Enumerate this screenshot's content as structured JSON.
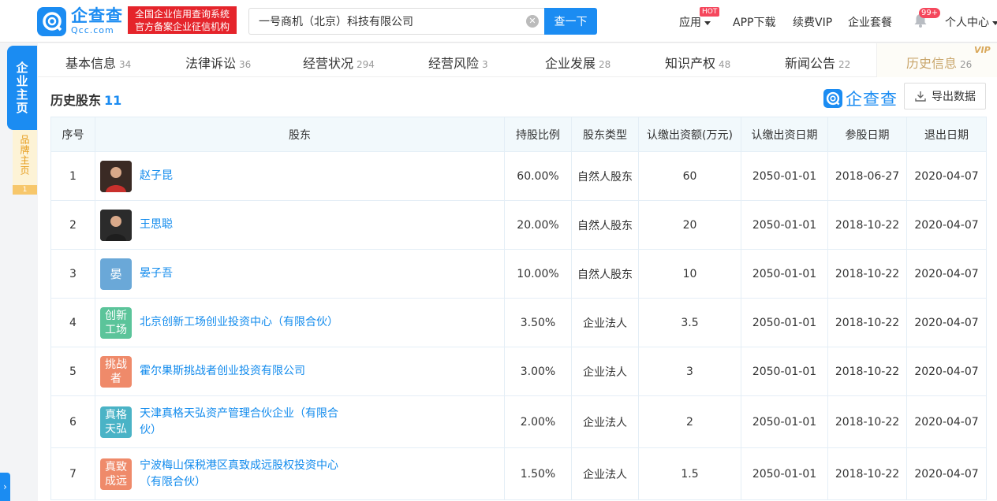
{
  "header": {
    "logo_cn": "企查查",
    "logo_en": "Qcc.com",
    "badge_line1": "全国企业信用查询系统",
    "badge_line2": "官方备案企业征信机构",
    "search_value": "一号商机（北京）科技有限公司",
    "search_button": "查一下",
    "nav": {
      "apps": "应用",
      "hot": "HOT",
      "app_download": "APP下载",
      "vip": "续费VIP",
      "package": "企业套餐",
      "msg_count": "99+",
      "user_center": "个人中心"
    }
  },
  "side": {
    "main": "企业主页",
    "brand": "品牌主页",
    "brand_count": "1"
  },
  "tabs": [
    {
      "label": "基本信息",
      "count": "34"
    },
    {
      "label": "法律诉讼",
      "count": "36"
    },
    {
      "label": "经营状况",
      "count": "294"
    },
    {
      "label": "经营风险",
      "count": "3"
    },
    {
      "label": "企业发展",
      "count": "28"
    },
    {
      "label": "知识产权",
      "count": "48"
    },
    {
      "label": "新闻公告",
      "count": "22"
    }
  ],
  "tab_active": {
    "label": "历史信息",
    "count": "26",
    "vip": "VIP"
  },
  "section": {
    "title": "历史股东",
    "count": "11",
    "brand_mark": "企查查",
    "export": "导出数据"
  },
  "table": {
    "headers": [
      "序号",
      "股东",
      "持股比例",
      "股东类型",
      "认缴出资额(万元)",
      "认缴出资日期",
      "参股日期",
      "退出日期"
    ],
    "rows": [
      {
        "no": "1",
        "name": "赵子昆",
        "avatar": "",
        "avatar_color": "#3a2a24",
        "ratio": "60.00%",
        "type": "自然人股东",
        "amount": "60",
        "sub_date": "2050-01-01",
        "join_date": "2018-06-27",
        "exit_date": "2020-04-07"
      },
      {
        "no": "2",
        "name": "王思聪",
        "avatar": "",
        "avatar_color": "#2b2b2b",
        "ratio": "20.00%",
        "type": "自然人股东",
        "amount": "20",
        "sub_date": "2050-01-01",
        "join_date": "2018-10-22",
        "exit_date": "2020-04-07"
      },
      {
        "no": "3",
        "name": "晏子吾",
        "avatar": "晏",
        "avatar_color": "#6aa8d8",
        "ratio": "10.00%",
        "type": "自然人股东",
        "amount": "10",
        "sub_date": "2050-01-01",
        "join_date": "2018-10-22",
        "exit_date": "2020-04-07"
      },
      {
        "no": "4",
        "name": "北京创新工场创业投资中心（有限合伙）",
        "avatar": "创新工场",
        "avatar_color": "#5bc49a",
        "ratio": "3.50%",
        "type": "企业法人",
        "amount": "3.5",
        "sub_date": "2050-01-01",
        "join_date": "2018-10-22",
        "exit_date": "2020-04-07"
      },
      {
        "no": "5",
        "name": "霍尔果斯挑战者创业投资有限公司",
        "avatar": "挑战者",
        "avatar_color": "#ef8a6a",
        "ratio": "3.00%",
        "type": "企业法人",
        "amount": "3",
        "sub_date": "2050-01-01",
        "join_date": "2018-10-22",
        "exit_date": "2020-04-07"
      },
      {
        "no": "6",
        "name": "天津真格天弘资产管理合伙企业（有限合伙）",
        "avatar": "真格天弘",
        "avatar_color": "#4ab3c6",
        "ratio": "2.00%",
        "type": "企业法人",
        "amount": "2",
        "sub_date": "2050-01-01",
        "join_date": "2018-10-22",
        "exit_date": "2020-04-07"
      },
      {
        "no": "7",
        "name": "宁波梅山保税港区真致成远股权投资中心（有限合伙）",
        "avatar": "真致成远",
        "avatar_color": "#ef8a6a",
        "ratio": "1.50%",
        "type": "企业法人",
        "amount": "1.5",
        "sub_date": "2050-01-01",
        "join_date": "2018-10-22",
        "exit_date": "2020-04-07"
      }
    ]
  },
  "colors": {
    "brand_blue": "#1b8cf2",
    "link_blue": "#128bed",
    "badge_red": "#e5242b",
    "vip_gold": "#c9a66b"
  }
}
